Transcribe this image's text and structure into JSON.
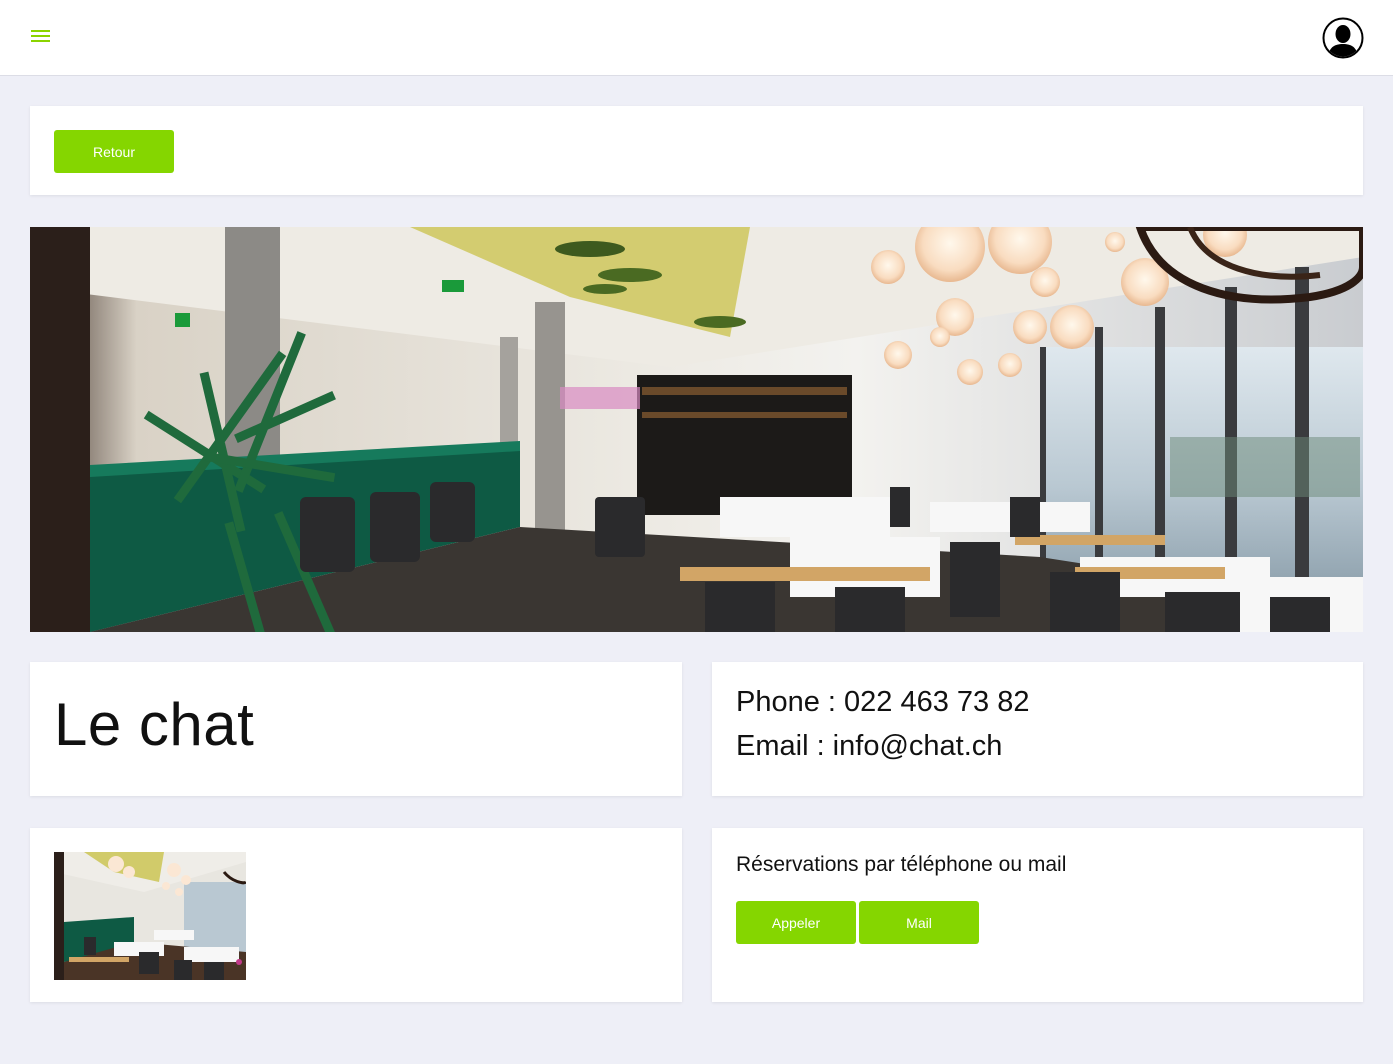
{
  "header": {
    "menu_icon": "hamburger-menu-icon",
    "profile_icon": "user-avatar-icon"
  },
  "back": {
    "label": "Retour"
  },
  "restaurant": {
    "name": "Le chat",
    "phone_label": "Phone : 022 463 73 82",
    "email_label": "Email : info@chat.ch"
  },
  "reservation": {
    "text": "Réservations par téléphone ou mail",
    "call_label": "Appeler",
    "mail_label": "Mail"
  },
  "colors": {
    "accent": "#85d600",
    "background": "#eeeff7",
    "card": "#ffffff"
  }
}
